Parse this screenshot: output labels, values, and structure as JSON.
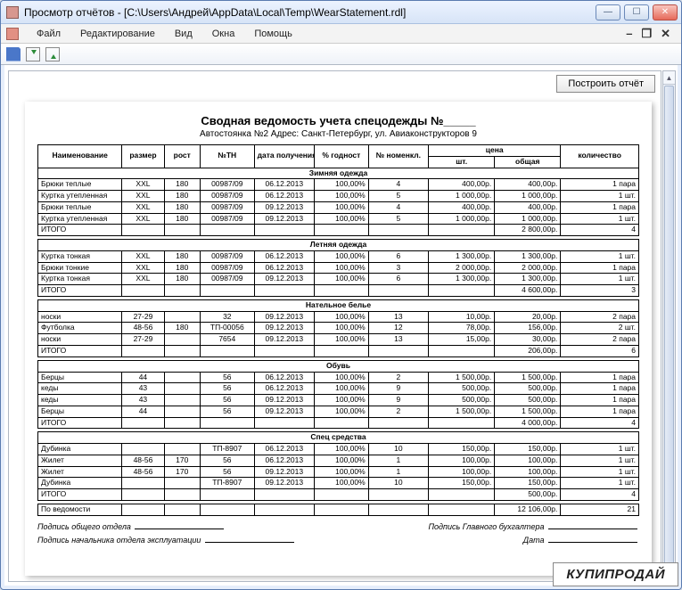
{
  "window": {
    "title": "Просмотр отчётов - [C:\\Users\\Андрей\\AppData\\Local\\Temp\\WearStatement.rdl]"
  },
  "menu": [
    "Файл",
    "Редактирование",
    "Вид",
    "Окна",
    "Помощь"
  ],
  "mdi": {
    "min": "–",
    "restore": "❐",
    "close": "✕"
  },
  "build_button": "Построить отчёт",
  "report": {
    "title": "Сводная  ведомость учета спецодежды  №_____",
    "subtitle": "Автостоянка №2   Адрес: Санкт-Петербург, ул. Авиаконструкторов 9"
  },
  "headers": {
    "name": "Наименование",
    "size": "размер",
    "height": "рост",
    "tn": "№ТН",
    "date": "дата получения",
    "pct": "% годност",
    "nomen": "№ номенкл.",
    "price": "цена",
    "price_unit": "шт.",
    "price_total": "общая",
    "qty": "количество"
  },
  "sections": [
    {
      "title": "Зимняя одежда",
      "rows": [
        {
          "name": "Брюки теплые",
          "size": "XXL",
          "height": "180",
          "tn": "00987/09",
          "date": "06.12.2013",
          "pct": "100,00%",
          "nomen": "4",
          "pu": "400,00р.",
          "pt": "400,00р.",
          "qty": "1 пара"
        },
        {
          "name": "Куртка утепленная",
          "size": "XXL",
          "height": "180",
          "tn": "00987/09",
          "date": "06.12.2013",
          "pct": "100,00%",
          "nomen": "5",
          "pu": "1 000,00р.",
          "pt": "1 000,00р.",
          "qty": "1 шт."
        },
        {
          "name": "Брюки теплые",
          "size": "XXL",
          "height": "180",
          "tn": "00987/09",
          "date": "09.12.2013",
          "pct": "100,00%",
          "nomen": "4",
          "pu": "400,00р.",
          "pt": "400,00р.",
          "qty": "1 пара"
        },
        {
          "name": "Куртка утепленная",
          "size": "XXL",
          "height": "180",
          "tn": "00987/09",
          "date": "09.12.2013",
          "pct": "100,00%",
          "nomen": "5",
          "pu": "1 000,00р.",
          "pt": "1 000,00р.",
          "qty": "1 шт."
        }
      ],
      "total": {
        "label": "ИТОГО",
        "pt": "2 800,00р.",
        "qty": "4"
      }
    },
    {
      "title": "Летняя одежда",
      "rows": [
        {
          "name": "Куртка тонкая",
          "size": "XXL",
          "height": "180",
          "tn": "00987/09",
          "date": "06.12.2013",
          "pct": "100,00%",
          "nomen": "6",
          "pu": "1 300,00р.",
          "pt": "1 300,00р.",
          "qty": "1 шт."
        },
        {
          "name": "Брюки тонкие",
          "size": "XXL",
          "height": "180",
          "tn": "00987/09",
          "date": "06.12.2013",
          "pct": "100,00%",
          "nomen": "3",
          "pu": "2 000,00р.",
          "pt": "2 000,00р.",
          "qty": "1 пара"
        },
        {
          "name": "Куртка тонкая",
          "size": "XXL",
          "height": "180",
          "tn": "00987/09",
          "date": "09.12.2013",
          "pct": "100,00%",
          "nomen": "6",
          "pu": "1 300,00р.",
          "pt": "1 300,00р.",
          "qty": "1 шт."
        }
      ],
      "total": {
        "label": "ИТОГО",
        "pt": "4 600,00р.",
        "qty": "3"
      }
    },
    {
      "title": "Нательное белье",
      "rows": [
        {
          "name": "носки",
          "size": "27-29",
          "height": "",
          "tn": "32",
          "date": "09.12.2013",
          "pct": "100,00%",
          "nomen": "13",
          "pu": "10,00р.",
          "pt": "20,00р.",
          "qty": "2 пара"
        },
        {
          "name": "Футболка",
          "size": "48-56",
          "height": "180",
          "tn": "ТП-00056",
          "date": "09.12.2013",
          "pct": "100,00%",
          "nomen": "12",
          "pu": "78,00р.",
          "pt": "156,00р.",
          "qty": "2 шт."
        },
        {
          "name": "носки",
          "size": "27-29",
          "height": "",
          "tn": "7654",
          "date": "09.12.2013",
          "pct": "100,00%",
          "nomen": "13",
          "pu": "15,00р.",
          "pt": "30,00р.",
          "qty": "2 пара"
        }
      ],
      "total": {
        "label": "ИТОГО",
        "pt": "206,00р.",
        "qty": "6"
      }
    },
    {
      "title": "Обувь",
      "rows": [
        {
          "name": "Берцы",
          "size": "44",
          "height": "",
          "tn": "56",
          "date": "06.12.2013",
          "pct": "100,00%",
          "nomen": "2",
          "pu": "1 500,00р.",
          "pt": "1 500,00р.",
          "qty": "1 пара"
        },
        {
          "name": "кеды",
          "size": "43",
          "height": "",
          "tn": "56",
          "date": "06.12.2013",
          "pct": "100,00%",
          "nomen": "9",
          "pu": "500,00р.",
          "pt": "500,00р.",
          "qty": "1 пара"
        },
        {
          "name": "кеды",
          "size": "43",
          "height": "",
          "tn": "56",
          "date": "09.12.2013",
          "pct": "100,00%",
          "nomen": "9",
          "pu": "500,00р.",
          "pt": "500,00р.",
          "qty": "1 пара"
        },
        {
          "name": "Берцы",
          "size": "44",
          "height": "",
          "tn": "56",
          "date": "09.12.2013",
          "pct": "100,00%",
          "nomen": "2",
          "pu": "1 500,00р.",
          "pt": "1 500,00р.",
          "qty": "1 пара"
        }
      ],
      "total": {
        "label": "ИТОГО",
        "pt": "4 000,00р.",
        "qty": "4"
      }
    },
    {
      "title": "Спец средства",
      "rows": [
        {
          "name": "Дубинка",
          "size": "",
          "height": "",
          "tn": "ТП-8907",
          "date": "06.12.2013",
          "pct": "100,00%",
          "nomen": "10",
          "pu": "150,00р.",
          "pt": "150,00р.",
          "qty": "1 шт."
        },
        {
          "name": "Жилет",
          "size": "48-56",
          "height": "170",
          "tn": "56",
          "date": "06.12.2013",
          "pct": "100,00%",
          "nomen": "1",
          "pu": "100,00р.",
          "pt": "100,00р.",
          "qty": "1 шт."
        },
        {
          "name": "Жилет",
          "size": "48-56",
          "height": "170",
          "tn": "56",
          "date": "09.12.2013",
          "pct": "100,00%",
          "nomen": "1",
          "pu": "100,00р.",
          "pt": "100,00р.",
          "qty": "1 шт."
        },
        {
          "name": "Дубинка",
          "size": "",
          "height": "",
          "tn": "ТП-8907",
          "date": "09.12.2013",
          "pct": "100,00%",
          "nomen": "10",
          "pu": "150,00р.",
          "pt": "150,00р.",
          "qty": "1 шт."
        }
      ],
      "total": {
        "label": "ИТОГО",
        "pt": "500,00р.",
        "qty": "4"
      }
    }
  ],
  "grand": {
    "label": "По ведомости",
    "pt": "12 106,00р.",
    "qty": "21"
  },
  "signatures": {
    "dept": "Подпись общего отдела",
    "accountant": "Подпись  Главного бухгалтера",
    "head": "Подпись начальника отдела эксплуатации",
    "date": "Дата"
  },
  "watermark": "КУПИПРОДАЙ"
}
